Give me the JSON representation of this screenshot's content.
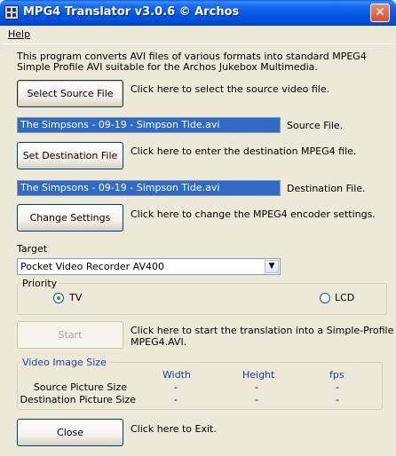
{
  "window": {
    "title": "MPG4 Translator v3.0.6 © Archos",
    "close_glyph": "✕"
  },
  "menu": {
    "help": "Help"
  },
  "intro": "This program converts AVI files of various formats into standard MPEG4 Simple Profile AVI suitable for the Archos Jukebox Multimedia.",
  "source": {
    "button": "Select Source File",
    "description": "Click here to select the source video file.",
    "value": "The Simpsons - 09-19 - Simpson Tide.avi",
    "label": "Source File."
  },
  "destination": {
    "button": "Set Destination File",
    "description": "Click here to enter the destination MPEG4 file.",
    "value": "The Simpsons - 09-19 - Simpson Tide.avi",
    "label": "Destination File."
  },
  "settings": {
    "button": "Change Settings",
    "description": "Click here to change the MPEG4 encoder settings."
  },
  "target": {
    "label": "Target",
    "selected": "Pocket Video Recorder AV400",
    "arrow": "▼"
  },
  "priority": {
    "legend": "Priority",
    "options": [
      {
        "label": "TV",
        "checked": true
      },
      {
        "label": "LCD",
        "checked": false
      }
    ]
  },
  "start": {
    "button": "Start",
    "description_line1": "Click here to start the translation into a Simple-Profile",
    "description_line2": "MPEG4.AVI."
  },
  "video_size": {
    "legend": "Video Image Size",
    "columns": [
      "Width",
      "Height",
      "fps"
    ],
    "rows": [
      {
        "label": "Source Picture Size",
        "values": [
          "-",
          "-",
          "-"
        ]
      },
      {
        "label": "Destination Picture Size",
        "values": [
          "-",
          "-",
          "-"
        ]
      }
    ]
  },
  "close": {
    "button": "Close",
    "description": "Click here to Exit."
  },
  "colors": {
    "titlebar": "#0055e5",
    "selection": "#316ac5",
    "window_bg": "#ece9d8"
  }
}
